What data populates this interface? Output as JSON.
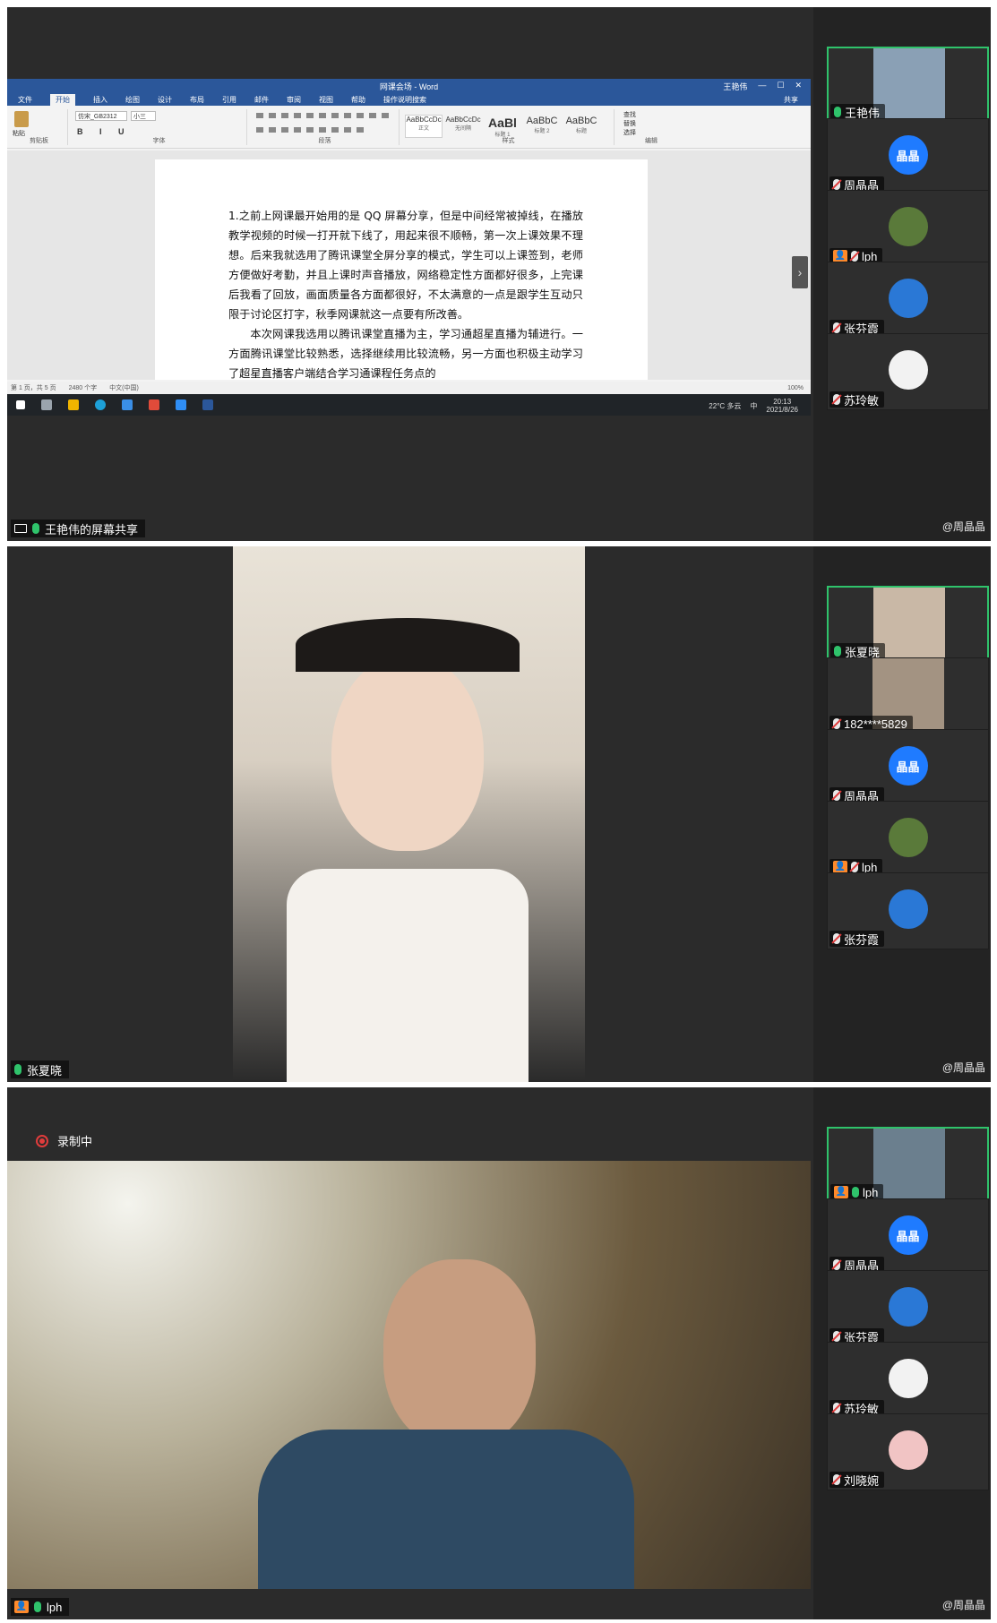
{
  "panel1": {
    "word": {
      "window_title": "网课会场 - Word",
      "user": "王艳伟",
      "tabs": [
        "文件",
        "开始",
        "插入",
        "绘图",
        "设计",
        "布局",
        "引用",
        "邮件",
        "审阅",
        "视图",
        "帮助",
        "操作说明搜索"
      ],
      "font_name": "仿宋_GB2312",
      "font_size": "小三",
      "groups": [
        "剪贴板",
        "字体",
        "段落",
        "样式",
        "编辑"
      ],
      "styles": [
        "正文",
        "无间隔",
        "标题 1",
        "标题 2",
        "标题"
      ],
      "styles_preview": [
        "AaBbCcDc",
        "AaBbCcDc",
        "AaBl",
        "AaBbC",
        "AaBbC"
      ],
      "edit_items": [
        "查找",
        "替换",
        "选择"
      ],
      "paste": "粘贴",
      "share": "共享",
      "paragraphs": [
        "1.之前上网课最开始用的是 QQ 屏幕分享，但是中间经常被掉线，在播放教学视频的时候一打开就下线了，用起来很不顺畅，第一次上课效果不理想。后来我就选用了腾讯课堂全屏分享的模式，学生可以上课签到，老师方便做好考勤，并且上课时声音播放，网络稳定性方面都好很多，上完课后我看了回放，画面质量各方面都很好，不太满意的一点是跟学生互动只限于讨论区打字，秋季网课就这一点要有所改善。",
        "本次网课我选用以腾讯课堂直播为主，学习通超星直播为辅进行。一方面腾讯课堂比较熟悉，选择继续用比较流畅，另一方面也积极主动学习了超星直播客户端结合学习通课程任务点的"
      ],
      "status_left": [
        "第 1 页，共 5 页",
        "2480 个字",
        "中文(中国)"
      ],
      "zoom": "100%"
    },
    "taskbar": {
      "weather": "22°C 多云",
      "ime": "中",
      "time": "20:13",
      "date": "2021/8/26"
    },
    "share_label": "王艳伟的屏幕共享",
    "watermark": "@周晶晶",
    "participants": [
      {
        "name": "王艳伟",
        "active": true,
        "mic": "on",
        "avatar": "video",
        "color": "#8aa0b5"
      },
      {
        "name": "周晶晶",
        "active": false,
        "mic": "off",
        "avatar": "晶晶",
        "color": "#1f7bff"
      },
      {
        "name": "lph",
        "active": false,
        "mic": "off",
        "host": true,
        "avatar": "food",
        "color": "#5a7a3a"
      },
      {
        "name": "张芬霞",
        "active": false,
        "mic": "off",
        "avatar": "doraemon",
        "color": "#2a78d6"
      },
      {
        "name": "苏玲敏",
        "active": false,
        "mic": "off",
        "avatar": "cat",
        "color": "#f2f2f2"
      }
    ]
  },
  "panel2": {
    "speaker_label": "张夏晓",
    "watermark": "@周晶晶",
    "participants": [
      {
        "name": "张夏晓",
        "active": true,
        "mic": "on",
        "avatar": "video",
        "color": "#c9b8a6"
      },
      {
        "name": "182****5829",
        "active": false,
        "mic": "off",
        "avatar": "video",
        "color": "#a39382"
      },
      {
        "name": "周晶晶",
        "active": false,
        "mic": "off",
        "avatar": "晶晶",
        "color": "#1f7bff"
      },
      {
        "name": "lph",
        "active": false,
        "mic": "off",
        "host": true,
        "avatar": "food",
        "color": "#5a7a3a"
      },
      {
        "name": "张芬霞",
        "active": false,
        "mic": "off",
        "avatar": "doraemon",
        "color": "#2a78d6"
      }
    ]
  },
  "panel3": {
    "recording_label": "录制中",
    "speaker_label": "lph",
    "watermark": "@周晶晶",
    "participants": [
      {
        "name": "lph",
        "active": true,
        "mic": "on",
        "host": true,
        "avatar": "video",
        "color": "#6b7f8e"
      },
      {
        "name": "周晶晶",
        "active": false,
        "mic": "off",
        "avatar": "晶晶",
        "color": "#1f7bff"
      },
      {
        "name": "张芬霞",
        "active": false,
        "mic": "off",
        "avatar": "doraemon",
        "color": "#2a78d6"
      },
      {
        "name": "苏玲敏",
        "active": false,
        "mic": "off",
        "avatar": "cat",
        "color": "#f2f2f2"
      },
      {
        "name": "刘晓婉",
        "active": false,
        "mic": "off",
        "avatar": "girl",
        "color": "#f1c4c4"
      }
    ]
  }
}
